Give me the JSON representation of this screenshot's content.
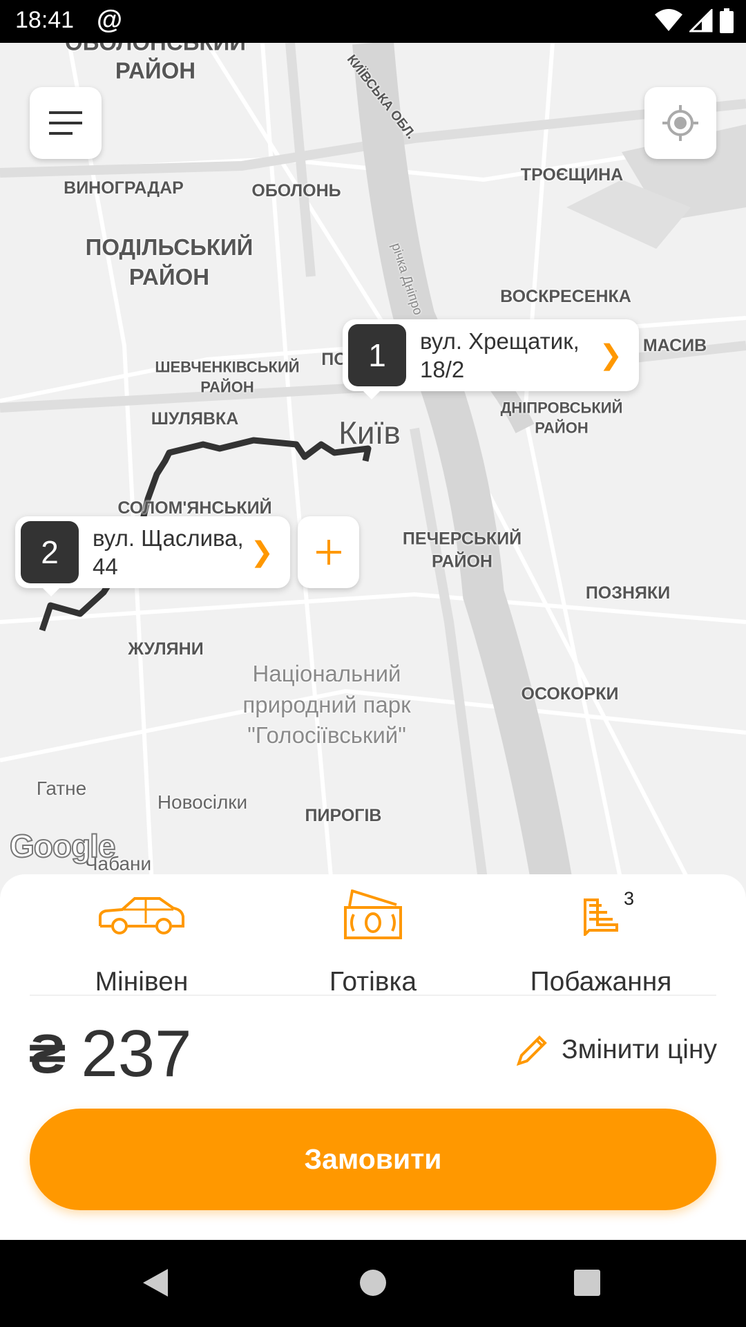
{
  "status_bar": {
    "time": "18:41",
    "notification_icon": "at-sign-icon",
    "icons": [
      "wifi-icon",
      "signal-icon",
      "battery-icon"
    ]
  },
  "map": {
    "labels": [
      {
        "text": "ОБОЛОНСЬКИЙ",
        "cls": "big"
      },
      {
        "text": "РАЙОН",
        "cls": "big"
      },
      {
        "text": "КИЇВСЬКА ОБЛ.",
        "cls": "rot"
      },
      {
        "text": "ВИНОГРАДАР",
        "cls": ""
      },
      {
        "text": "ОБОЛОНЬ",
        "cls": ""
      },
      {
        "text": "ТРОЄЩИНА",
        "cls": ""
      },
      {
        "text": "ПОДІЛЬСЬКИЙ\nРАЙОН",
        "cls": "big"
      },
      {
        "text": "річка Дніпро",
        "cls": "river"
      },
      {
        "text": "ВОСКРЕСЕНКА",
        "cls": ""
      },
      {
        "text": "МАСИВ",
        "cls": ""
      },
      {
        "text": "ПО",
        "cls": ""
      },
      {
        "text": "ШЕВЧЕНКІВСЬКИЙ\nРАЙОН",
        "cls": "small"
      },
      {
        "text": "ДНІПРОВСЬКИЙ\nРАЙОН",
        "cls": "small"
      },
      {
        "text": "ШУЛЯВКА",
        "cls": ""
      },
      {
        "text": "Київ",
        "cls": "city"
      },
      {
        "text": "СОЛОМ'ЯНСЬКИЙ",
        "cls": ""
      },
      {
        "text": "ПЕЧЕРСЬКИЙ\nРАЙОН",
        "cls": ""
      },
      {
        "text": "ПОЗНЯКИ",
        "cls": ""
      },
      {
        "text": "ЖУЛЯНИ",
        "cls": ""
      },
      {
        "text": "Національний природний парк \"Голосіївський\"",
        "cls": "park"
      },
      {
        "text": "ОСОКОРКИ",
        "cls": ""
      },
      {
        "text": "Гатне",
        "cls": "town"
      },
      {
        "text": "Новосілки",
        "cls": "town"
      },
      {
        "text": "ПИРОГІВ",
        "cls": ""
      },
      {
        "text": "Чабани",
        "cls": "town"
      }
    ],
    "attribution": "Google",
    "menu_icon": "hamburger-menu-icon",
    "locate_icon": "my-location-icon",
    "stops": [
      {
        "number": "1",
        "address": "вул. Хрещатик, 18/2"
      },
      {
        "number": "2",
        "address": "вул. Щаслива, 44"
      }
    ],
    "add_stop_icon": "plus-icon",
    "accent": "#ff9800",
    "route_color": "#333333"
  },
  "options": [
    {
      "label": "Мінівен",
      "icon": "car-icon"
    },
    {
      "label": "Готівка",
      "icon": "cash-icon"
    },
    {
      "label": "Побажання",
      "icon": "wishes-icon",
      "badge": "3"
    }
  ],
  "price": {
    "currency": "₴",
    "amount": "237"
  },
  "edit_price": {
    "label": "Змінити ціну",
    "icon": "pencil-icon"
  },
  "order_button": {
    "label": "Замовити"
  },
  "nav_bar": {
    "icons": [
      "back-icon",
      "home-icon",
      "recents-icon"
    ]
  }
}
